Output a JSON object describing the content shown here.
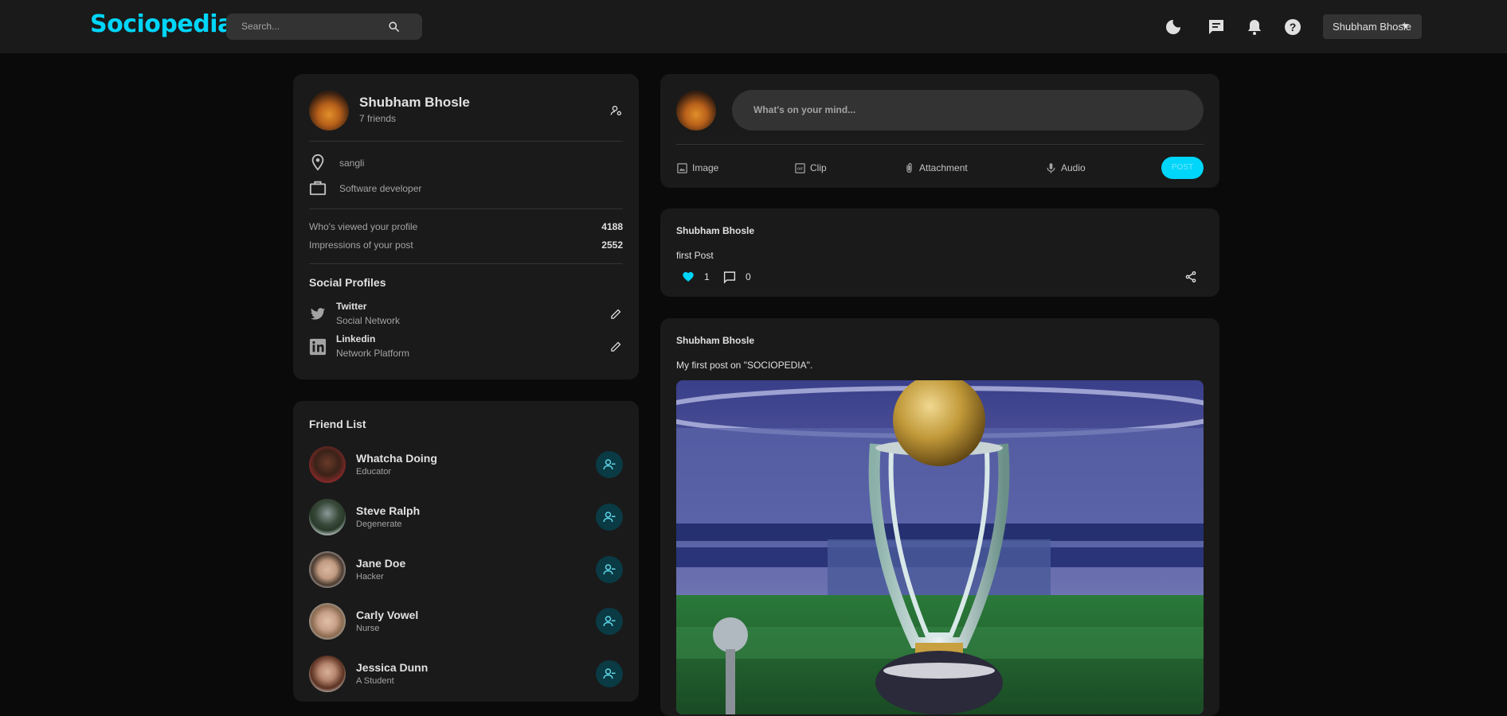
{
  "nav": {
    "logo": "Sociopedia",
    "search_placeholder": "Search...",
    "user_name": "Shubham Bhosle"
  },
  "user_card": {
    "name": "Shubham Bhosle",
    "friends": "7 friends",
    "location": "sangli",
    "occupation": "Software developer",
    "viewed_label": "Who's viewed your profile",
    "viewed_value": "4188",
    "impressions_label": "Impressions of your post",
    "impressions_value": "2552",
    "social_title": "Social Profiles",
    "social": [
      {
        "name": "Twitter",
        "sub": "Social Network"
      },
      {
        "name": "Linkedin",
        "sub": "Network Platform"
      }
    ]
  },
  "friend_list": {
    "title": "Friend List",
    "friends": [
      {
        "name": "Whatcha Doing",
        "role": "Educator"
      },
      {
        "name": "Steve Ralph",
        "role": "Degenerate"
      },
      {
        "name": "Jane Doe",
        "role": "Hacker"
      },
      {
        "name": "Carly Vowel",
        "role": "Nurse"
      },
      {
        "name": "Jessica Dunn",
        "role": "A Student"
      }
    ]
  },
  "composer": {
    "placeholder": "What's on your mind...",
    "actions": [
      "Image",
      "Clip",
      "Attachment",
      "Audio"
    ],
    "post_label": "POST"
  },
  "posts": [
    {
      "author": "Shubham Bhosle",
      "text": "first Post",
      "likes": "1",
      "comments": "0"
    },
    {
      "author": "Shubham Bhosle",
      "text": "My first post on \"SOCIOPEDIA\"."
    }
  ],
  "colors": {
    "accent": "#00d5fa",
    "card": "#1a1a1a",
    "background": "#0a0a0a"
  }
}
